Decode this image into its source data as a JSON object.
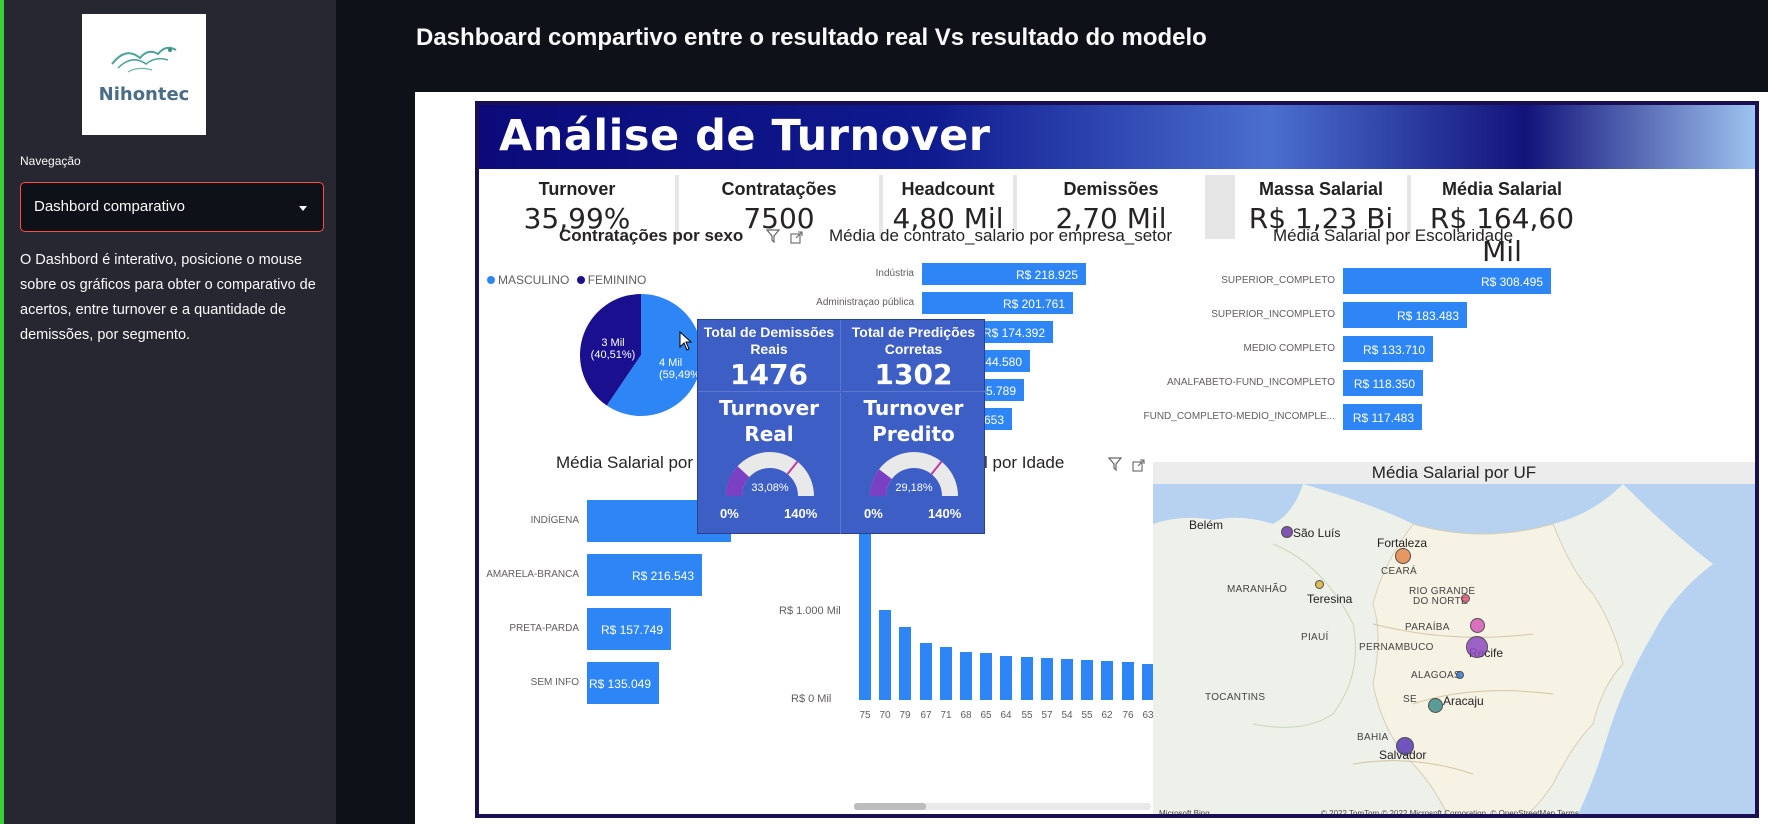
{
  "sidebar": {
    "logo_text": "Nihontec",
    "nav_label": "Navegação",
    "select_value": "Dashbord comparativo",
    "description": "O Dashbord é interativo, posicione o mouse sobre os gráficos para obter o comparativo de acertos, entre turnover e a quantidade de demissões, por segmento."
  },
  "page": {
    "title": "Dashboard compartivo entre o resultado real Vs resultado do modelo"
  },
  "report": {
    "banner_title": "Análise de Turnover",
    "kpis": [
      {
        "label": "Turnover",
        "value": "35,99%"
      },
      {
        "label": "Contratações",
        "value": "7500"
      },
      {
        "label": "Headcount",
        "value": "4,80 Mil"
      },
      {
        "label": "Demissões",
        "value": "2,70 Mil"
      },
      {
        "label": "Massa Salarial",
        "value": "R$ 1,23 Bi"
      },
      {
        "label": "Média Salarial",
        "value": "R$ 164,60 Mil"
      }
    ],
    "titles": {
      "pie": "Contratações por sexo",
      "setor": "Média de contrato_salario por empresa_setor",
      "escolaridade": "Média Salarial por Escolaridade",
      "raca": "Média Salarial por Ra",
      "idade": "l por Idade",
      "uf": "Média Salarial por UF"
    },
    "tooltip": {
      "dem_reais_label": "Total de Demissões Reais",
      "dem_reais_value": "1476",
      "pred_label": "Total de Predições Corretas",
      "pred_value": "1302",
      "turnover_real_label": "Turnover Real",
      "turnover_pred_label": "Turnover Predito",
      "gauge_min": "0%",
      "gauge_max": "140%"
    },
    "map": {
      "cities": [
        "Belém",
        "São Luís",
        "Fortaleza",
        "Teresina",
        "Recife",
        "Aracaju",
        "Salvador"
      ],
      "states": [
        "CEARÁ",
        "MARANHÃO",
        "RIO GRANDE",
        "DO NORTE",
        "PARAÍBA",
        "PIAUÍ",
        "PERNAMBUCO",
        "ALAGOAS",
        "SE",
        "TOCANTINS",
        "BAHIA"
      ],
      "microsoft_label": "Microsoft Bing",
      "copyright": "© 2022 TomTom © 2022 Microsoft Corporation. © OpenStreetMap  Terms"
    },
    "colors": {
      "bar": "#2e86f6",
      "masc": "#2e86f6",
      "fem": "#1a0f8f",
      "banner": "#0c0a7a"
    }
  },
  "chart_data": [
    {
      "type": "pie",
      "title": "Contratações por sexo",
      "legend": [
        "MASCULINO",
        "FEMININO"
      ],
      "slices": [
        {
          "name": "MASCULINO",
          "value": 59.49,
          "label": "4 Mil",
          "pct": "(59,49%)"
        },
        {
          "name": "FEMININO",
          "value": 40.51,
          "label": "3 Mil",
          "pct": "(40,51%)"
        }
      ]
    },
    {
      "type": "bar",
      "orientation": "horizontal",
      "title": "Média de contrato_salario por empresa_setor",
      "categories": [
        "Indústria",
        "Administraçao pública",
        "",
        "",
        "",
        ""
      ],
      "values": [
        218925,
        201761,
        174392,
        144580,
        135789,
        120653
      ],
      "labels": [
        "R$ 218.925",
        "R$ 201.761",
        "R$ 174.392",
        "R$ 144.580",
        "R$ 135.789",
        ".653"
      ]
    },
    {
      "type": "bar",
      "orientation": "horizontal",
      "title": "Média Salarial por Escolaridade",
      "categories": [
        "SUPERIOR_COMPLETO",
        "SUPERIOR_INCOMPLETO",
        "MEDIO COMPLETO",
        "ANALFABETO-FUND_INCOMPLETO",
        "FUND_COMPLETO-MEDIO_INCOMPLE..."
      ],
      "values": [
        308495,
        183483,
        133710,
        118350,
        117483
      ],
      "labels": [
        "R$ 308.495",
        "R$ 183.483",
        "R$ 133.710",
        "R$ 118.350",
        "R$ 117.483"
      ]
    },
    {
      "type": "bar",
      "orientation": "horizontal",
      "title": "Média Salarial por Ra",
      "categories": [
        "INDÍGENA",
        "AMARELA-BRANCA",
        "PRETA-PARDA",
        "SEM INFO"
      ],
      "values": [
        270000,
        216543,
        157749,
        135049
      ],
      "labels": [
        "R$ 2",
        "R$ 216.543",
        "R$ 157.749",
        "R$ 135.049"
      ]
    },
    {
      "type": "bar",
      "title": "l por Idade",
      "categories": [
        "75",
        "70",
        "79",
        "67",
        "71",
        "68",
        "65",
        "64",
        "55",
        "57",
        "54",
        "55",
        "62",
        "76",
        "63"
      ],
      "values": [
        1650000,
        840000,
        680000,
        530000,
        490000,
        450000,
        440000,
        410000,
        400000,
        390000,
        380000,
        370000,
        360000,
        350000,
        330000
      ],
      "yticks": [
        "R$ 0 Mil",
        "R$ 1.000 Mil"
      ],
      "ylim": [
        0,
        1700000
      ]
    },
    {
      "type": "gauge",
      "title": "Turnover Real",
      "value": 33.08,
      "label": "33,08%",
      "min": 0,
      "max": 140
    },
    {
      "type": "gauge",
      "title": "Turnover Predito",
      "value": 29.18,
      "label": "29,18%",
      "min": 0,
      "max": 140
    }
  ]
}
